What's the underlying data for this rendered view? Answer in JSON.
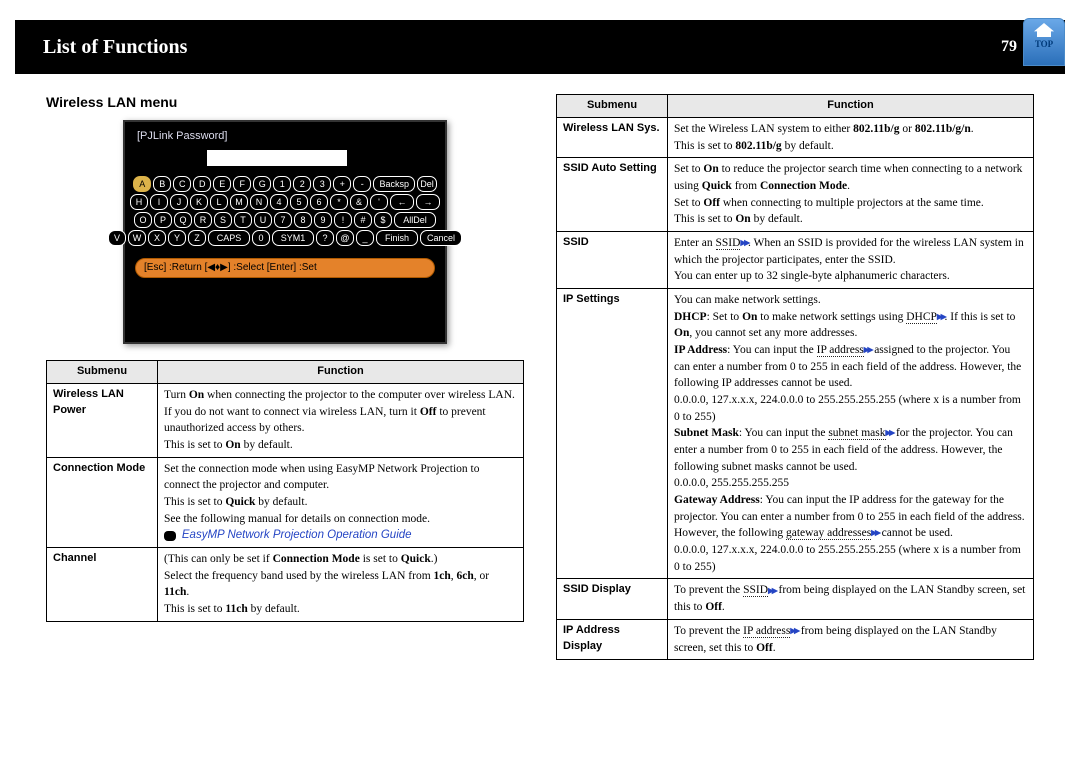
{
  "header": {
    "title": "List of Functions",
    "page_number": "79",
    "top_label": "TOP"
  },
  "left": {
    "section_title": "Wireless LAN menu",
    "screenshot": {
      "title": "[PJLink Password]",
      "rows": [
        [
          "A",
          "B",
          "C",
          "D",
          "E",
          "F",
          "G",
          "1",
          "2",
          "3",
          "+",
          "-",
          "Backsp",
          "Del"
        ],
        [
          "H",
          "I",
          "J",
          "K",
          "L",
          "M",
          "N",
          "4",
          "5",
          "6",
          "*",
          "&",
          "'",
          "←",
          "→"
        ],
        [
          "O",
          "P",
          "Q",
          "R",
          "S",
          "T",
          "U",
          "7",
          "8",
          "9",
          "!",
          "#",
          "$",
          "AllDel"
        ],
        [
          "V",
          "W",
          "X",
          "Y",
          "Z",
          "CAPS",
          "0",
          "SYM1",
          "?",
          "@",
          "_",
          "Finish",
          "Cancel"
        ]
      ],
      "bottom_bar": "[Esc] :Return [◀♦▶] :Select [Enter] :Set"
    },
    "table": {
      "headers": [
        "Submenu",
        "Function"
      ],
      "rows": [
        {
          "submenu": "Wireless LAN Power",
          "lines": [
            {
              "pre": "Turn ",
              "b": "On",
              "post": " when connecting the projector to the computer over wireless LAN."
            },
            {
              "pre": "If you do not want to connect via wireless LAN, turn it ",
              "b": "Off",
              "post": " to prevent unauthorized access by others."
            },
            {
              "pre": "This is set to ",
              "b": "On",
              "post": " by default."
            }
          ]
        },
        {
          "submenu": "Connection Mode",
          "lines": [
            {
              "pre": "Set the connection mode when using EasyMP Network Projection to connect the projector and computer.",
              "b": "",
              "post": ""
            },
            {
              "pre": "This is set to ",
              "b": "Quick",
              "post": " by default."
            },
            {
              "pre": "See the following manual for details on connection mode.",
              "b": "",
              "post": ""
            }
          ],
          "guide": "EasyMP Network Projection Operation Guide"
        },
        {
          "submenu": "Channel",
          "lines": [
            {
              "pre": "(This can only be set if ",
              "b": "Connection Mode",
              "post": " is set to ",
              "b2": "Quick",
              "post2": ".)"
            },
            {
              "pre": "Select the frequency band used by the wireless LAN from ",
              "b": "1ch",
              "post": ", ",
              "b2": "6ch",
              "post2": ", or ",
              "b3": "11ch",
              "post3": "."
            },
            {
              "pre": "This is set to ",
              "b": "11ch",
              "post": " by default."
            }
          ]
        }
      ]
    }
  },
  "right": {
    "table": {
      "headers": [
        "Submenu",
        "Function"
      ],
      "rows": [
        {
          "submenu": "Wireless LAN Sys.",
          "html": "Set the Wireless LAN system to either <b>802.11b/g</b> or <b>802.11b/g/n</b>.<br>This is set to <b>802.11b/g</b> by default."
        },
        {
          "submenu": "SSID Auto Setting",
          "html": "Set to <b>On</b> to reduce the projector search time when connecting to a network using <b>Quick</b> from <b>Connection Mode</b>.<br>Set to <b>Off</b> when connecting to multiple projectors at the same time.<br>This is set to <b>On</b> by default."
        },
        {
          "submenu": "SSID",
          "html": "Enter an <span class='dotu'>SSID</span><span class='gloss-icon'>▸▸</span>. When an SSID is provided for the wireless LAN system in which the projector participates, enter the SSID.<br>You can enter up to 32 single-byte alphanumeric characters."
        },
        {
          "submenu": "IP Settings",
          "html": "You can make network settings.<br><b>DHCP</b>: Set to <b>On</b> to make network settings using <span class='dotu'>DHCP</span><span class='gloss-icon'>▸▸</span>. If this is set to <b>On</b>, you cannot set any more addresses.<br><b>IP Address</b>: You can input the <span class='dotu'>IP address</span><span class='gloss-icon'>▸▸</span> assigned to the projector. You can enter a number from 0 to 255 in each field of the address. However, the following IP addresses cannot be used.<br>0.0.0.0, 127.x.x.x, 224.0.0.0 to 255.255.255.255 (where x is a number from 0 to 255)<br><b>Subnet Mask</b>: You can input the <span class='dotu'>subnet mask</span><span class='gloss-icon'>▸▸</span> for the projector. You can enter a number from 0 to 255 in each field of the address. However, the following subnet masks cannot be used.<br>0.0.0.0, 255.255.255.255<br><b>Gateway Address</b>: You can input the IP address for the gateway for the projector. You can enter a number from 0 to 255 in each field of the address. However, the following <span class='dotu'>gateway addresses</span><span class='gloss-icon'>▸▸</span> cannot be used.<br>0.0.0.0, 127.x.x.x, 224.0.0.0 to 255.255.255.255 (where x is a number from 0 to 255)"
        },
        {
          "submenu": "SSID Display",
          "html": "To prevent the <span class='dotu'>SSID</span><span class='gloss-icon'>▸▸</span> from being displayed on the LAN Standby screen, set this to <b>Off</b>."
        },
        {
          "submenu": "IP Address Display",
          "html": "To prevent the <span class='dotu'>IP address</span><span class='gloss-icon'>▸▸</span> from being displayed on the LAN Standby screen, set this to <b>Off</b>."
        }
      ]
    }
  }
}
